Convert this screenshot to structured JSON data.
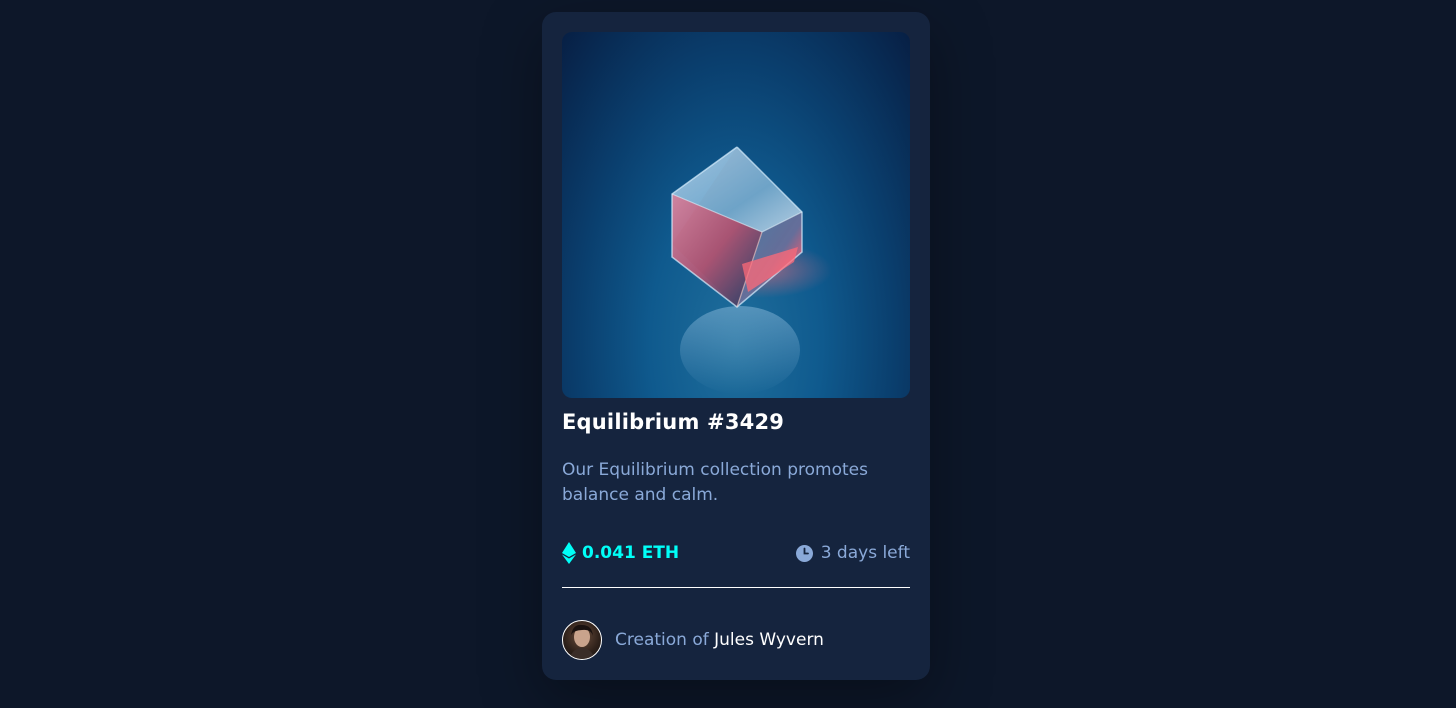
{
  "card": {
    "image_alt": "Equilibrium crystal cube",
    "title": "Equilibrium #3429",
    "description": "Our Equilibrium collection promotes balance and calm.",
    "price": "0.041 ETH",
    "time_left": "3 days left",
    "creator_prefix": "Creation of",
    "creator_name": "Jules Wyvern"
  },
  "icons": {
    "price": "ethereum-icon",
    "time": "clock-icon"
  },
  "colors": {
    "page_background": "#0d1729",
    "card_background": "#15243e",
    "accent_cyan": "#00fff8",
    "soft_blue": "#8aa9d8",
    "white": "#ffffff"
  }
}
